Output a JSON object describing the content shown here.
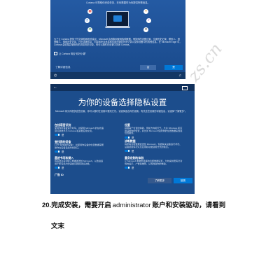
{
  "colors": {
    "oobe_background": "#1c4d8c",
    "accent": "#0078d7",
    "page_background": "#ffffff",
    "watermark": "#969696"
  },
  "cortana_screen": {
    "header_text": "Cortana 可帮助你完成任务，在你需要时为你提供所需信息。",
    "icons": [
      "calendar-icon",
      "reminder-icon",
      "mail-icon",
      "weather-icon",
      "music-icon",
      "settings-icon"
    ],
    "body_text": "为了让 Cortana 提供个性化体验和相关建议，Microsoft 会收集和使用各种数据，例如你的设备位置、位置历史记录、联系人、语音输入、搜索历史记录、日历详细信息、内容和来自消息和应用的通信历史记录以及你设备中的其他信息。在 Microsoft Edge 中，Cortana 会收集并使用你的浏览历史记录。你可以随时在设置中关闭 Cortana。",
    "checkbox_label": "让 Cortana 响应“你好小娜”",
    "buttons": {
      "learn_more": "了解详细信息",
      "no": "否",
      "yes": "是"
    }
  },
  "privacy_screen": {
    "title": "为你的设备选择隐私设置",
    "subtitle": "Microsoft 将为你提供这些设置，你可以随时在设置中更改它们。请选择适合你的设置。有关这些设置的详细信息，请选择“了解更多”。",
    "left_settings": [
      {
        "heading": "在线语音识别",
        "description": "使用你的语音进行听写，并使用 Microsoft 的在线语音识别技术与 Cortana 和其他应用交流。",
        "toggle": "是"
      },
      {
        "heading": "查找我的设备",
        "description": "打开“查找我的设备”，并使用你设备的位置数据来帮助你在设备丢失时找到它。",
        "toggle": "是"
      },
      {
        "heading": "墨迹书写和键入",
        "description": "将墨迹书写和键入数据发送给 Microsoft，以改进适用于所有用户的语言识别和建议功能。",
        "toggle": "是"
      },
      {
        "heading": "广告 ID"
      }
    ],
    "right_settings": [
      {
        "heading": "位置",
        "description": "获取基于位置的体验，例如方向和天气。允许 Windows 和应用请求你的位置，并允许 Microsoft 使用你的位置数据来改进位置服务。",
        "toggle": "是"
      },
      {
        "heading": "诊断数据",
        "description": "将所有诊断数据发送给 Microsoft，包括有关设备运行状况、设备使用情况以及应用和功能使用方式的信息。",
        "toggle": "是"
      },
      {
        "heading": "量身定制的体验",
        "description": "让 Microsoft 根据你选择的诊断数据设置，为你提供更有针对性的提示、广告和推荐，从而改进你的体验。",
        "toggle": "是"
      }
    ],
    "buttons": {
      "learn_more": "了解更多",
      "accept": "接受"
    }
  },
  "step": {
    "number": "20.",
    "text_a": "完成安装，需要开启",
    "text_b": "administrator",
    "text_c": "账户和安装驱动，请看到",
    "line2": "文末"
  },
  "watermark": {
    "text": "zs.cn"
  }
}
